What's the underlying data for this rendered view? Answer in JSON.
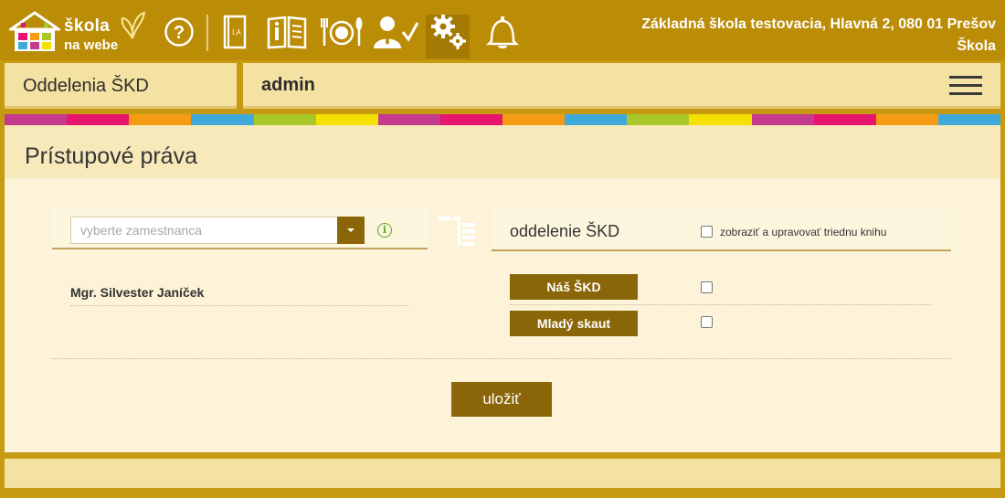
{
  "app": {
    "logo_line1": "škola",
    "logo_line2": "na webe"
  },
  "nav_icons": [
    "help-icon",
    "class-book-icon",
    "textbook-icon",
    "dining-icon",
    "attendance-icon",
    "settings-icon",
    "notification-bell-icon"
  ],
  "school": {
    "name": "Základná škola testovacia, Hlavná 2, 080 01 Prešov",
    "type": "Škola"
  },
  "header": {
    "section": "Oddelenia ŠKD",
    "user": "admin"
  },
  "stripe_colors": [
    "#c43a8c",
    "#e8156e",
    "#f59c14",
    "#3fa9dc",
    "#a8c82a",
    "#f5e100",
    "#c43a8c",
    "#e8156e",
    "#f59c14",
    "#3fa9dc",
    "#a8c82a",
    "#f5e100",
    "#c43a8c",
    "#e8156e",
    "#f59c14",
    "#3fa9dc"
  ],
  "main": {
    "title": "Prístupové práva",
    "employee_select": {
      "placeholder": "vyberte zamestnanca",
      "info": "i"
    },
    "department": {
      "label": "oddelenie ŠKD",
      "book_option": "zobraziť a upravovať triednu knihu"
    },
    "employees": [
      "Mgr. Silvester Janíček"
    ],
    "departments": [
      {
        "name": "Náš ŠKD",
        "checked": false
      },
      {
        "name": "Mladý skaut",
        "checked": false
      }
    ],
    "save_label": "uložiť"
  },
  "colors": {
    "primary": "#8b6608",
    "topbar": "#bb8c06",
    "panel": "#fcf3d8",
    "accent_green": "#5da51d"
  }
}
